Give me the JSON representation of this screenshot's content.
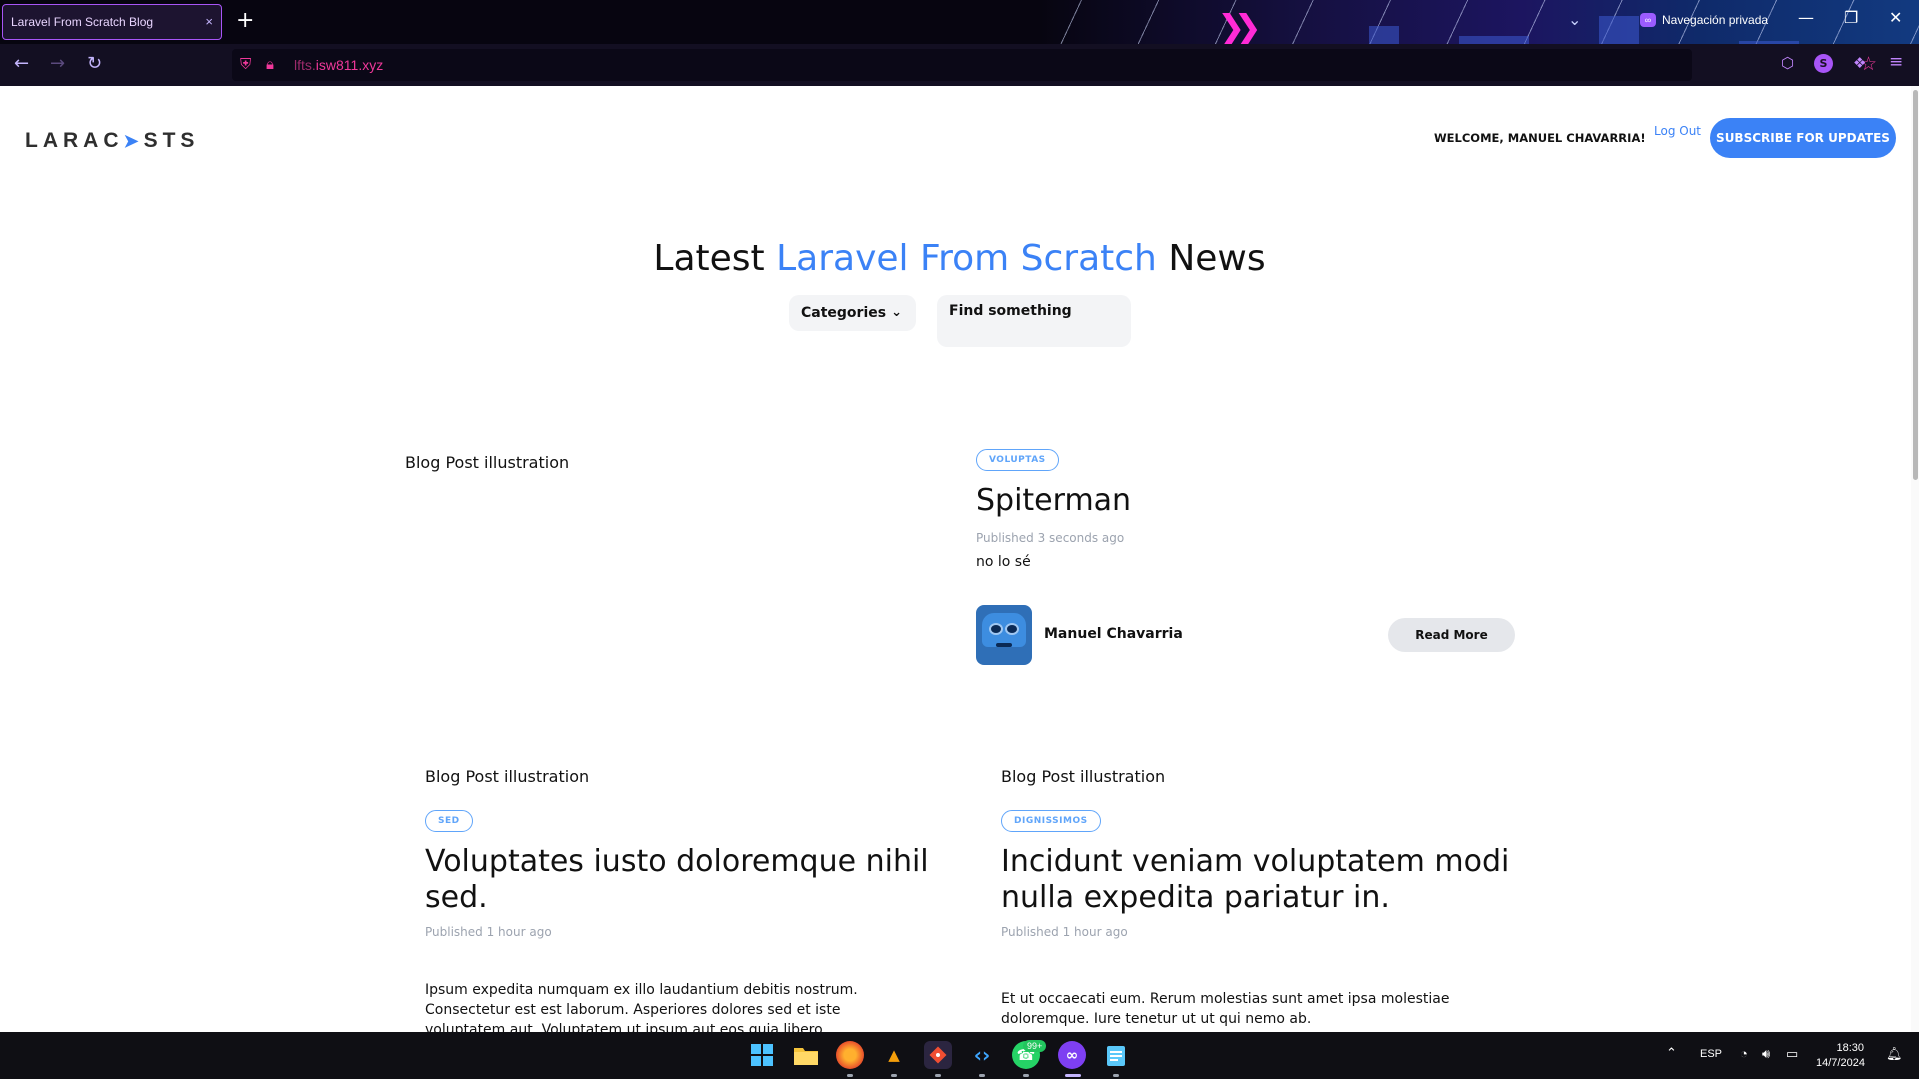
{
  "browser": {
    "tab_title": "Laravel From Scratch Blog",
    "tab_close": "×",
    "new_tab": "+",
    "private_label": "Navegación privada",
    "url_host_dim": "lfts.",
    "url_host": "isw811.xyz",
    "back": "←",
    "forward": "→",
    "reload": "↻",
    "star": "☆",
    "minimize": "—",
    "restore": "❐",
    "close": "✕",
    "menu": "≡",
    "profile_initial": "S"
  },
  "site": {
    "logo_text": "LARACASTS",
    "welcome": "WELCOME, MANUEL CHAVARRIA!",
    "logout": "Log Out",
    "subscribe": "SUBSCRIBE FOR UPDATES"
  },
  "hero": {
    "prefix": "Latest",
    "accent": "Laravel From Scratch",
    "suffix": "News",
    "categories_label": "Categories",
    "search_placeholder": "Find something"
  },
  "featured_post": {
    "image_alt": "Blog Post illustration",
    "category": "VOLUPTAS",
    "title": "Spiterman",
    "published_prefix": "Published",
    "published_time": "3 seconds ago",
    "excerpt": "no lo sé",
    "author": "Manuel Chavarria",
    "read_more": "Read More"
  },
  "posts": [
    {
      "image_alt": "Blog Post illustration",
      "category": "SED",
      "title": "Voluptates iusto doloremque nihil sed.",
      "published_prefix": "Published",
      "published_time": "1 hour ago",
      "excerpt": "Ipsum expedita numquam ex illo laudantium debitis nostrum. Consectetur est est laborum. Asperiores dolores sed et iste voluptatem aut. Voluptatem ut ipsum aut eos quia libero."
    },
    {
      "image_alt": "Blog Post illustration",
      "category": "DIGNISSIMOS",
      "title": "Incidunt veniam voluptatem modi nulla expedita pariatur in.",
      "published_prefix": "Published",
      "published_time": "1 hour ago",
      "excerpt": "Et ut occaecati eum. Rerum molestias sunt amet ipsa molestiae doloremque. Iure tenetur ut ut qui nemo ab."
    }
  ],
  "taskbar": {
    "whatsapp_badge": "99+",
    "lang": "ESP",
    "time": "18:30",
    "date": "14/7/2024"
  },
  "colors": {
    "accent": "#3b82f6",
    "url_pink": "#f0389a",
    "private_purple": "#a855f7"
  }
}
